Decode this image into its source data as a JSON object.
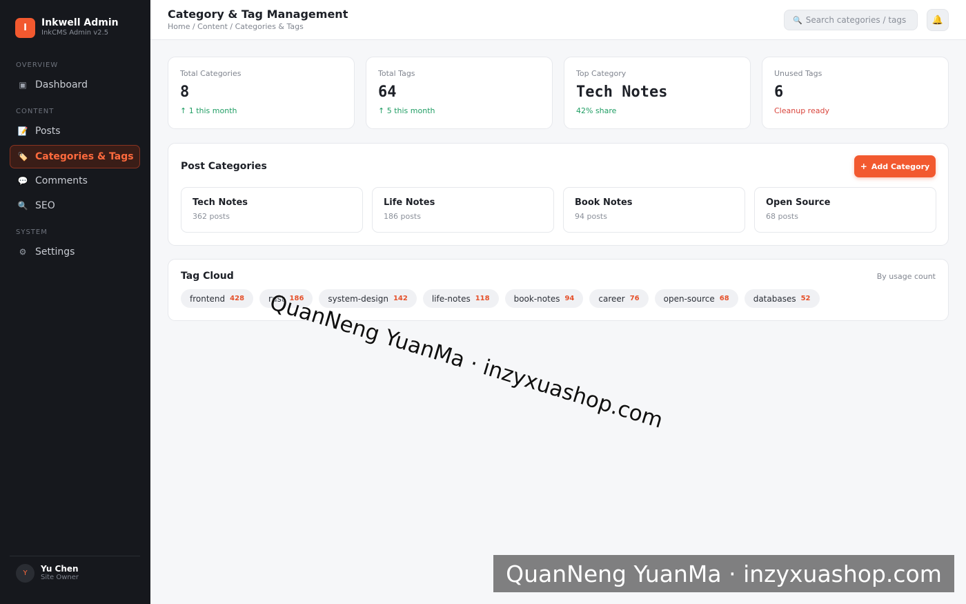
{
  "brand": {
    "initial": "I",
    "title": "Inkwell Admin",
    "subtitle": "InkCMS Admin v2.5"
  },
  "sidebar": {
    "sections": [
      {
        "label": "OVERVIEW",
        "items": [
          {
            "label": "Dashboard",
            "icon": "dashboard-icon",
            "glyph": "▣"
          }
        ]
      },
      {
        "label": "CONTENT",
        "items": [
          {
            "label": "Posts",
            "icon": "memo-icon",
            "glyph": "📝"
          },
          {
            "label": "Categories & Tags",
            "icon": "tag-icon",
            "glyph": "🏷️",
            "active": true
          },
          {
            "label": "Comments",
            "icon": "speech-bubble-icon",
            "glyph": "💬"
          },
          {
            "label": "SEO",
            "icon": "magnifier-icon",
            "glyph": "🔍"
          }
        ]
      },
      {
        "label": "SYSTEM",
        "items": [
          {
            "label": "Settings",
            "icon": "gear-icon",
            "glyph": "⚙"
          }
        ]
      }
    ]
  },
  "user": {
    "initial": "Y",
    "name": "Yu Chen",
    "role": "Site Owner"
  },
  "header": {
    "title": "Category & Tag Management",
    "breadcrumb": "Home / Content / Categories & Tags",
    "search_placeholder": "Search categories / tags",
    "search_icon": "🔍",
    "bell_icon": "🔔"
  },
  "stats": [
    {
      "label": "Total Categories",
      "value": "8",
      "note": "↑ 1 this month",
      "tone": "green"
    },
    {
      "label": "Total Tags",
      "value": "64",
      "note": "↑ 5 this month",
      "tone": "green"
    },
    {
      "label": "Top Category",
      "value": "Tech Notes",
      "note": "42% share",
      "tone": "green"
    },
    {
      "label": "Unused Tags",
      "value": "6",
      "note": "Cleanup ready",
      "tone": "red"
    }
  ],
  "categories": {
    "title": "Post Categories",
    "add_label": "Add Category",
    "add_icon": "+",
    "items": [
      {
        "name": "Tech Notes",
        "count": "362 posts"
      },
      {
        "name": "Life Notes",
        "count": "186 posts"
      },
      {
        "name": "Book Notes",
        "count": "94 posts"
      },
      {
        "name": "Open Source",
        "count": "68 posts"
      }
    ]
  },
  "tag_cloud": {
    "title": "Tag Cloud",
    "note": "By usage count",
    "tags": [
      {
        "name": "frontend",
        "count": "428"
      },
      {
        "name": "rust",
        "count": "186"
      },
      {
        "name": "system-design",
        "count": "142"
      },
      {
        "name": "life-notes",
        "count": "118"
      },
      {
        "name": "book-notes",
        "count": "94"
      },
      {
        "name": "career",
        "count": "76"
      },
      {
        "name": "open-source",
        "count": "68"
      },
      {
        "name": "databases",
        "count": "52"
      }
    ]
  },
  "watermark": {
    "text": "QuanNeng YuanMa · inzyxuashop.com"
  },
  "colors": {
    "accent": "#f2592f",
    "sidebar_bg": "#16181d",
    "positive": "#1f9d63",
    "negative": "#d9443b"
  }
}
